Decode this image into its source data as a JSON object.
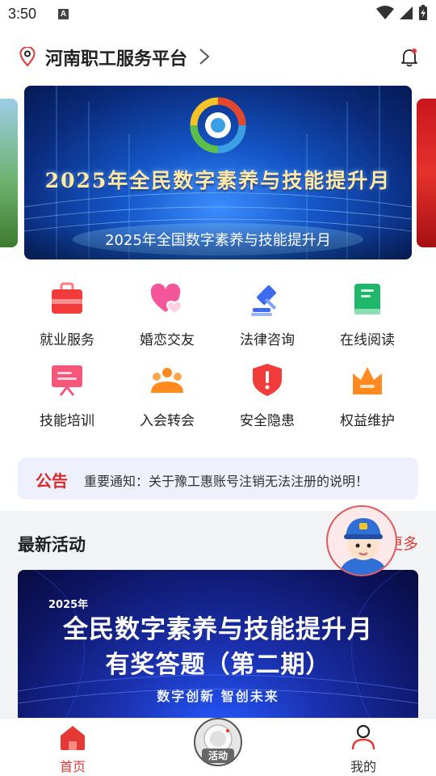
{
  "status_bar": {
    "time": "3:50",
    "notif_badge": "A"
  },
  "header": {
    "title": "河南职工服务平台"
  },
  "banner": {
    "headline": "2025年全民数字素养与技能提升月",
    "caption": "2025年全国数字素养与技能提升月"
  },
  "services": [
    {
      "label": "就业服务",
      "icon": "briefcase-icon"
    },
    {
      "label": "婚恋交友",
      "icon": "hearts-icon"
    },
    {
      "label": "法律咨询",
      "icon": "gavel-icon"
    },
    {
      "label": "在线阅读",
      "icon": "book-icon"
    },
    {
      "label": "技能培训",
      "icon": "presentation-icon"
    },
    {
      "label": "入会转会",
      "icon": "members-icon"
    },
    {
      "label": "安全隐患",
      "icon": "shield-alert-icon"
    },
    {
      "label": "权益维护",
      "icon": "crown-icon"
    }
  ],
  "notice": {
    "tag": "公告",
    "text": "重要通知：关于豫工惠账号注销无法注册的说明！"
  },
  "activity": {
    "title": "最新活动",
    "more": "更多",
    "card": {
      "year": "2025年",
      "line1": "全民数字素养与技能提升月",
      "line2": "有奖答题（第二期）",
      "slogan": "数字创新 智创未来"
    }
  },
  "tabbar": {
    "home": "首页",
    "center": "活动",
    "mine": "我的"
  },
  "colors": {
    "accent": "#e53935",
    "notice_bg": "#eef1fb",
    "banner_blue": "#1456c8"
  }
}
